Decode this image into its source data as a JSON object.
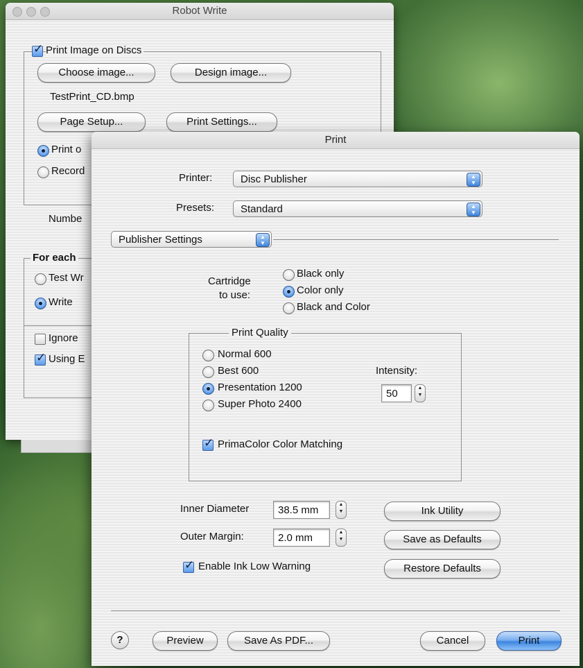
{
  "back_window": {
    "title": "Robot Write",
    "print_image_checkbox": "Print Image on Discs",
    "choose_image_button": "Choose image...",
    "design_image_button": "Design image...",
    "filename": "TestPrint_CD.bmp",
    "page_setup_button": "Page Setup...",
    "print_settings_button": "Print Settings...",
    "radio_print_only": "Print o",
    "radio_record": "Record",
    "number_label": "Numbe",
    "for_each_legend": "For each",
    "radio_test_write": "Test Wr",
    "radio_write": "Write",
    "ignore_checkbox": "Ignore",
    "using_checkbox": "Using E"
  },
  "print_dialog": {
    "title": "Print",
    "printer_label": "Printer:",
    "printer_value": "Disc Publisher",
    "presets_label": "Presets:",
    "presets_value": "Standard",
    "panel_value": "Publisher Settings",
    "cartridge_label_1": "Cartridge",
    "cartridge_label_2": "to use:",
    "cartridge_options": [
      "Black only",
      "Color only",
      "Black and Color"
    ],
    "cartridge_selected": "Color only",
    "print_quality_legend": "Print Quality",
    "quality_options": [
      "Normal 600",
      "Best 600",
      "Presentation 1200",
      "Super Photo 2400"
    ],
    "quality_selected": "Presentation 1200",
    "intensity_label": "Intensity:",
    "intensity_value": "50",
    "primacolor_checkbox": "PrimaColor Color Matching",
    "inner_diameter_label": "Inner Diameter",
    "inner_diameter_value": "38.5 mm",
    "outer_margin_label": "Outer Margin:",
    "outer_margin_value": "2.0 mm",
    "ink_low_checkbox": "Enable Ink Low Warning",
    "ink_utility_button": "Ink Utility",
    "save_defaults_button": "Save as Defaults",
    "restore_defaults_button": "Restore Defaults",
    "help_button": "?",
    "preview_button": "Preview",
    "save_pdf_button": "Save As PDF...",
    "cancel_button": "Cancel",
    "print_button": "Print"
  }
}
